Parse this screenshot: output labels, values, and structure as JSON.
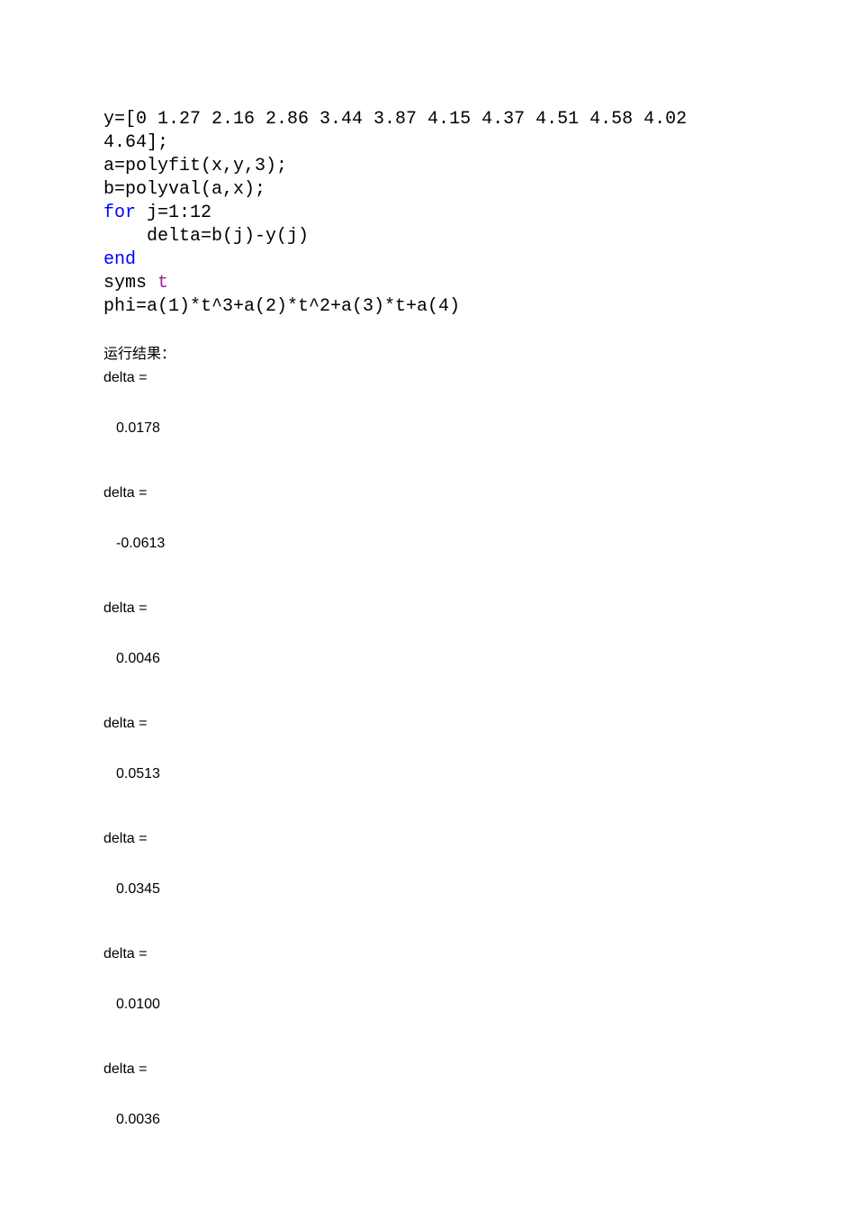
{
  "code": {
    "line1_a": "y=[0 1.27 2.16 2.86 3.44 3.87 4.15 4.37 4.51 4.58 4.02 ",
    "line1_b": "4.64];",
    "line2": "a=polyfit(x,y,3);",
    "line3": "b=polyval(a,x);",
    "line4_kw": "for",
    "line4_rest": " j=1:12",
    "line5": "    delta=b(j)-y(j)",
    "line6_kw": "end",
    "line7_a": "syms ",
    "line7_sym": "t",
    "line8": "phi=a(1)*t^3+a(2)*t^2+a(3)*t+a(4)"
  },
  "result_label": "运行结果：",
  "deltas": [
    {
      "label": "delta =",
      "value": "0.0178"
    },
    {
      "label": "delta =",
      "value": "-0.0613"
    },
    {
      "label": "delta =",
      "value": "0.0046"
    },
    {
      "label": "delta =",
      "value": "0.0513"
    },
    {
      "label": "delta =",
      "value": "0.0345"
    },
    {
      "label": "delta =",
      "value": "0.0100"
    },
    {
      "label": "delta =",
      "value": "0.0036"
    }
  ]
}
